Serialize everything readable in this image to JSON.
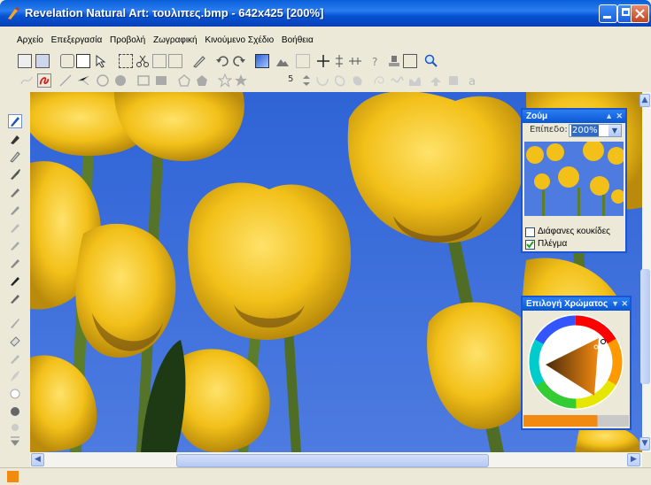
{
  "window": {
    "title": "Revelation Natural Art: τουλιπες.bmp - 642x425 [200%]"
  },
  "menu": [
    "Αρχείο",
    "Επεξεργασία",
    "Προβολή",
    "Ζωγραφική",
    "Κινούμενο Σχέδιο",
    "Βοήθεια"
  ],
  "toolbar2": {
    "brush_size": "5"
  },
  "zoom_panel": {
    "title": "Ζούμ",
    "level_label": "Επίπεδο:",
    "level_value": "200%",
    "transparent_pixels_label": "Διάφανες κουκίδες",
    "transparent_pixels_checked": false,
    "grid_label": "Πλέγμα",
    "grid_checked": true
  },
  "color_panel": {
    "title": "Επιλογή Χρώματος",
    "current_color": "#f28a10"
  },
  "colors": {
    "sky": "#3f6fdc",
    "tulip": "#f2c019",
    "stem": "#5c7d2a",
    "accent": "#f28a10"
  }
}
